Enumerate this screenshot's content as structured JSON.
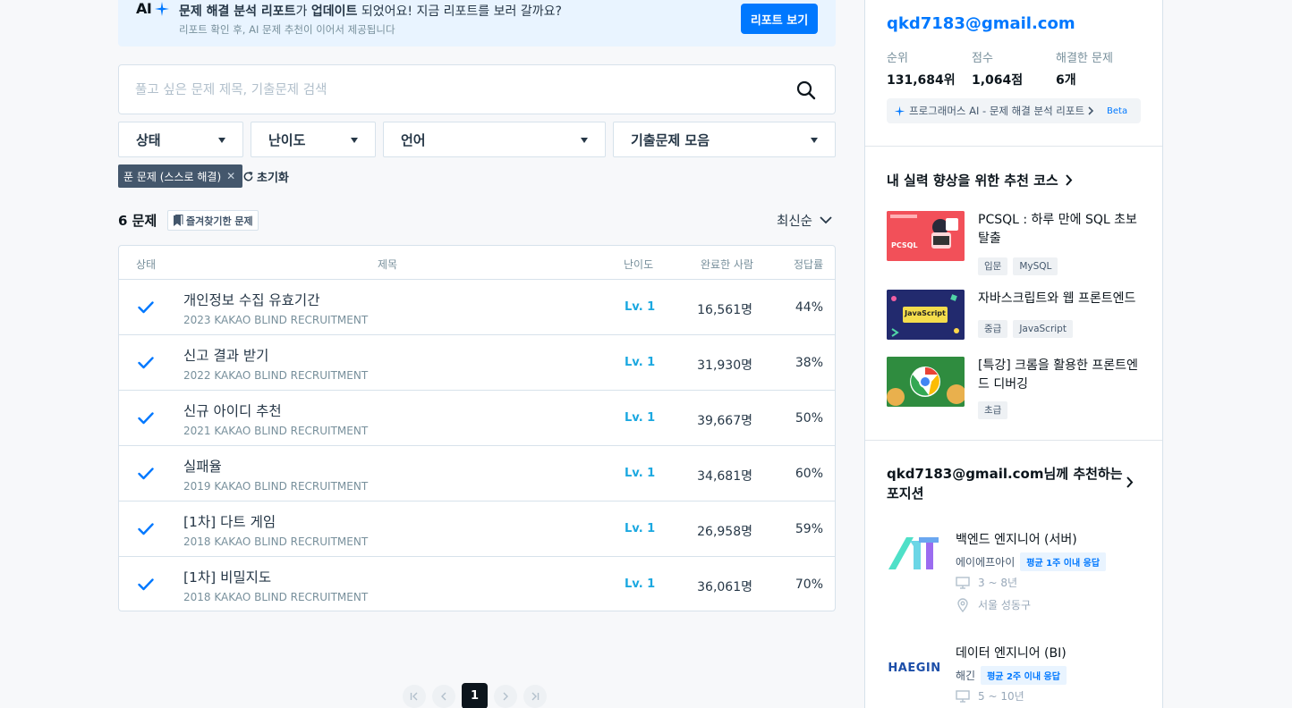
{
  "banner": {
    "ai_label": "AI",
    "message_parts": [
      "문제 해결 분석 리포트",
      "가 ",
      "업데이트",
      " 되었어요! 지금 리포트를 보러 갈까요?"
    ],
    "sub": "리포트 확인 후, AI 문제 추천이 이어서 제공됩니다",
    "button": "리포트 보기"
  },
  "search": {
    "placeholder": "풀고 싶은 문제 제목, 기출문제 검색"
  },
  "filters": [
    "상태",
    "난이도",
    "언어",
    "기출문제 모음"
  ],
  "active_chip": "푼 문제 (스스로 해결)",
  "reset_label": "초기화",
  "list": {
    "count": "6 문제",
    "favorites": "즐겨찾기한 문제",
    "sort": "최신순",
    "headers": {
      "status": "상태",
      "title": "제목",
      "level": "난이도",
      "solved": "완료한 사람",
      "rate": "정답률"
    },
    "rows": [
      {
        "title": "개인정보 수집 유효기간",
        "source": "2023 KAKAO BLIND RECRUITMENT",
        "level": "Lv. 1",
        "solved": "16,561명",
        "rate": "44%"
      },
      {
        "title": "신고 결과 받기",
        "source": "2022 KAKAO BLIND RECRUITMENT",
        "level": "Lv. 1",
        "solved": "31,930명",
        "rate": "38%"
      },
      {
        "title": "신규 아이디 추천",
        "source": "2021 KAKAO BLIND RECRUITMENT",
        "level": "Lv. 1",
        "solved": "39,667명",
        "rate": "50%"
      },
      {
        "title": "실패율",
        "source": "2019 KAKAO BLIND RECRUITMENT",
        "level": "Lv. 1",
        "solved": "34,681명",
        "rate": "60%"
      },
      {
        "title": "[1차] 다트 게임",
        "source": "2018 KAKAO BLIND RECRUITMENT",
        "level": "Lv. 1",
        "solved": "26,958명",
        "rate": "59%"
      },
      {
        "title": "[1차] 비밀지도",
        "source": "2018 KAKAO BLIND RECRUITMENT",
        "level": "Lv. 1",
        "solved": "36,061명",
        "rate": "70%"
      }
    ]
  },
  "pagination": {
    "current": "1"
  },
  "profile": {
    "email": "qkd7183@gmail.com",
    "rank_label": "순위",
    "rank": "131,684위",
    "score_label": "점수",
    "score": "1,064점",
    "solved_label": "해결한 문제",
    "solved": "6개",
    "ai_report": "프로그래머스 AI - 문제 해결 분석 리포트",
    "beta": "Beta"
  },
  "courses": {
    "title": "내 실력 향상을 위한 추천 코스",
    "items": [
      {
        "title": "PCSQL : 하루 만에 SQL 초보 탈출",
        "tags": [
          "입문",
          "MySQL"
        ],
        "thumb_text": "PCSQL"
      },
      {
        "title": "자바스크립트와 웹 프론트엔드",
        "tags": [
          "중급",
          "JavaScript"
        ],
        "thumb_text": "JavaScript"
      },
      {
        "title": "[특강] 크롬을 활용한 프론트엔드 디버깅",
        "tags": [
          "초급"
        ],
        "thumb_text": ""
      }
    ]
  },
  "positions": {
    "title_line1": "qkd7183@gmail.com님께 추천하는",
    "title_line2": "포지션",
    "items": [
      {
        "title": "백엔드 엔지니어 (서버)",
        "company": "에이에프아이",
        "badge": "평균 1주 이내 응답",
        "career": "3 ~ 8년",
        "location": "서울 성동구"
      },
      {
        "title": "데이터 엔지니어 (BI)",
        "company": "해긴",
        "badge": "평균 2주 이내 응답",
        "career": "5 ~ 10년",
        "logo_text": "HAEGIN"
      }
    ]
  },
  "colors": {
    "accent": "#0078ff",
    "level": "#1ba8e0",
    "chip": "#44576c",
    "banner_bg": "#e9f4ff"
  }
}
